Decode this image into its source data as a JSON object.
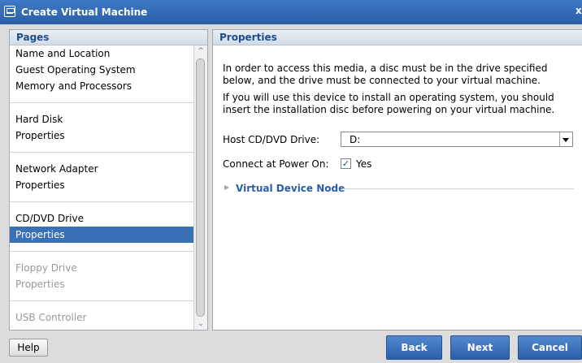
{
  "window": {
    "title": "Create Virtual Machine",
    "close_glyph": "x"
  },
  "left_panel": {
    "header": "Pages",
    "groups": [
      {
        "items": [
          {
            "label": "Name and Location",
            "state": "normal"
          },
          {
            "label": "Guest Operating System",
            "state": "normal"
          },
          {
            "label": "Memory and Processors",
            "state": "normal"
          }
        ]
      },
      {
        "items": [
          {
            "label": "Hard Disk",
            "state": "normal"
          },
          {
            "label": "Properties",
            "state": "normal"
          }
        ]
      },
      {
        "items": [
          {
            "label": "Network Adapter",
            "state": "normal"
          },
          {
            "label": "Properties",
            "state": "normal"
          }
        ]
      },
      {
        "items": [
          {
            "label": "CD/DVD Drive",
            "state": "normal"
          },
          {
            "label": "Properties",
            "state": "selected"
          }
        ]
      },
      {
        "items": [
          {
            "label": "Floppy Drive",
            "state": "disabled"
          },
          {
            "label": "Properties",
            "state": "disabled"
          }
        ]
      },
      {
        "items": [
          {
            "label": "USB Controller",
            "state": "disabled"
          }
        ]
      }
    ]
  },
  "right_panel": {
    "header": "Properties",
    "paragraph1": "In order to access this media, a disc must be in the drive specified below, and the drive must be connected to your virtual machine.",
    "paragraph2": "If you will use this device to install an operating system, you should insert the installation disc before powering on your virtual machine.",
    "host_drive": {
      "label": "Host CD/DVD Drive:",
      "value": "D:"
    },
    "connect_at_power_on": {
      "label": "Connect at Power On:",
      "checked": true,
      "option_label": "Yes"
    },
    "virtual_device_node": {
      "label": "Virtual Device Node",
      "expanded": false
    }
  },
  "buttons": {
    "help": "Help",
    "back": "Back",
    "next": "Next",
    "cancel": "Cancel"
  },
  "colors": {
    "title_bar": "#2f67b3",
    "selection": "#3a70b5",
    "link": "#2a5fa8",
    "header_text": "#1f4e8c"
  },
  "icons": {
    "window_icon": "vm-icon",
    "expander": "triangle-right-icon",
    "dropdown": "chevron-down-icon",
    "check": "checkmark-icon"
  }
}
